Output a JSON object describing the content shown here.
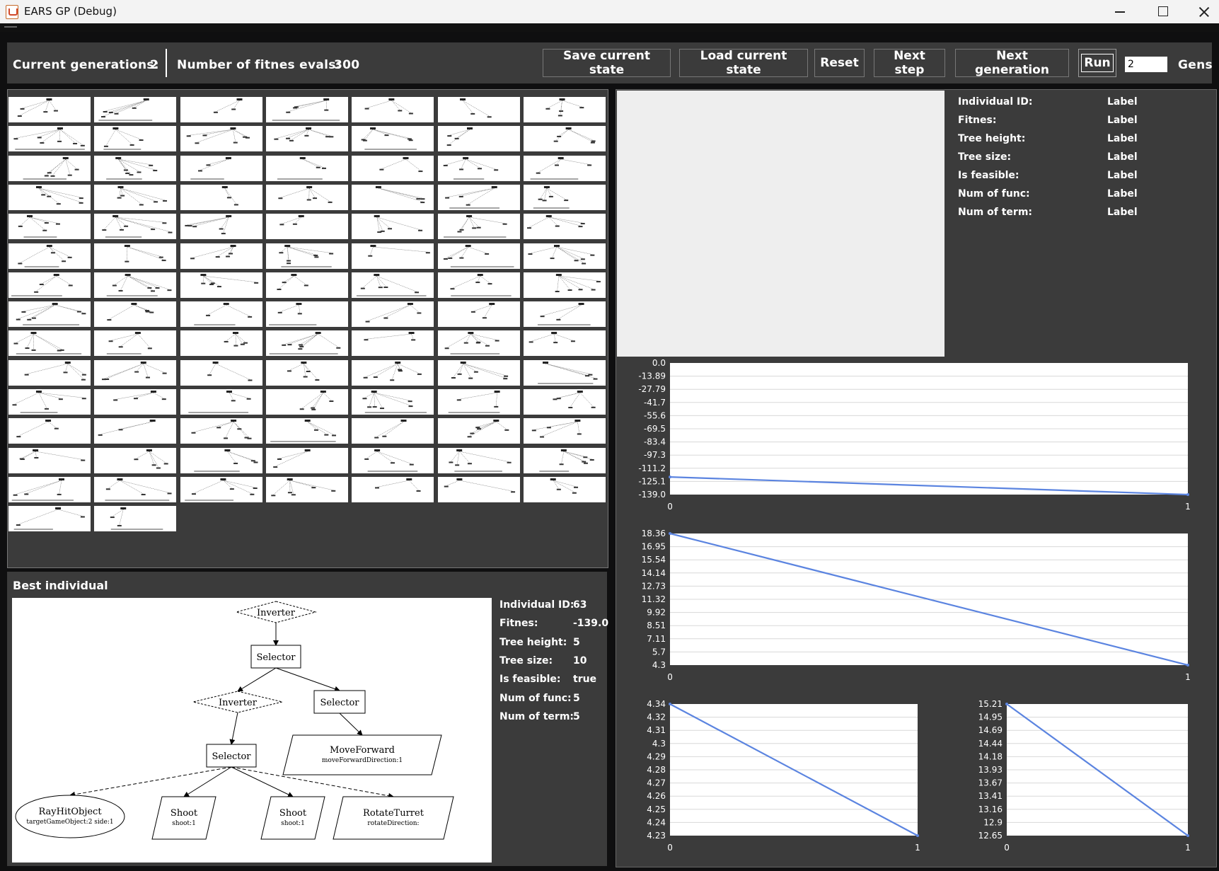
{
  "window": {
    "title": "EARS GP (Debug)"
  },
  "toolbar": {
    "generations_label": "Current generations:",
    "generations_value": "2",
    "evals_label": "Number of fitnes evals:",
    "evals_value": "300",
    "save_label": "Save current state",
    "load_label": "Load current state",
    "reset_label": "Reset",
    "next_step_label": "Next step",
    "next_generation_label": "Next generation",
    "run_label": "Run",
    "gens_value": "2",
    "gens_label": "Gens"
  },
  "population": {
    "count": 100
  },
  "selected": {
    "labels": [
      "Individual ID:",
      "Fitnes:",
      "Tree height:",
      "Tree size:",
      "Is feasible:",
      "Num of func:",
      "Num of term:"
    ],
    "values": [
      "Label",
      "Label",
      "Label",
      "Label",
      "Label",
      "Label",
      "Label"
    ]
  },
  "best": {
    "title": "Best individual",
    "labels": [
      "Individual ID:",
      "Fitnes:",
      "Tree height:",
      "Tree size:",
      "Is feasible:",
      "Num of func:",
      "Num of term:"
    ],
    "values": [
      "63",
      "-139.0",
      "5",
      "10",
      "true",
      "5",
      "5"
    ],
    "tree": {
      "nodes": [
        {
          "id": "n1",
          "label": "Inverter",
          "sub": "",
          "shape": "diamond"
        },
        {
          "id": "n2",
          "label": "Selector",
          "sub": "",
          "shape": "box"
        },
        {
          "id": "n3",
          "label": "Inverter",
          "sub": "",
          "shape": "diamond"
        },
        {
          "id": "n4",
          "label": "Selector",
          "sub": "",
          "shape": "box"
        },
        {
          "id": "n5",
          "label": "MoveForward",
          "sub": "moveForwardDirection:1",
          "shape": "parallelogram"
        },
        {
          "id": "n6",
          "label": "Selector",
          "sub": "",
          "shape": "box"
        },
        {
          "id": "n7",
          "label": "RayHitObject",
          "sub": "targetGameObject:2 side:1",
          "shape": "ellipse"
        },
        {
          "id": "n8",
          "label": "Shoot",
          "sub": "shoot:1",
          "shape": "parallelogram"
        },
        {
          "id": "n9",
          "label": "Shoot",
          "sub": "shoot:1",
          "shape": "parallelogram"
        },
        {
          "id": "n10",
          "label": "RotateTurret",
          "sub": "rotateDirection:",
          "shape": "parallelogram"
        }
      ],
      "edges": [
        [
          "n1",
          "n2"
        ],
        [
          "n2",
          "n3"
        ],
        [
          "n2",
          "n4"
        ],
        [
          "n4",
          "n5"
        ],
        [
          "n3",
          "n6"
        ],
        [
          "n6",
          "n7"
        ],
        [
          "n6",
          "n8"
        ],
        [
          "n6",
          "n9"
        ],
        [
          "n6",
          "n10"
        ]
      ]
    }
  },
  "colors": {
    "line": "#5b84e0",
    "panel": "#3b3b3b",
    "background": "#0f0f10"
  },
  "chart_data": [
    {
      "type": "line",
      "x": [
        0,
        1
      ],
      "series": [
        {
          "values": [
            -120.4,
            -139.0
          ]
        }
      ],
      "y_ticks": [
        "0.0",
        "-13.89",
        "-27.79",
        "-41.7",
        "-55.6",
        "-69.5",
        "-83.4",
        "-97.3",
        "-111.2",
        "-125.1",
        "-139.0"
      ],
      "x_ticks": [
        "0",
        "1"
      ],
      "ylim": [
        -139.0,
        0.0
      ],
      "grid": true
    },
    {
      "type": "line",
      "x": [
        0,
        1
      ],
      "series": [
        {
          "values": [
            18.36,
            4.3
          ]
        }
      ],
      "y_ticks": [
        "18.36",
        "16.95",
        "15.54",
        "14.14",
        "12.73",
        "11.32",
        "9.92",
        "8.51",
        "7.11",
        "5.7",
        "4.3"
      ],
      "x_ticks": [
        "0",
        "1"
      ],
      "ylim": [
        4.3,
        18.36
      ],
      "grid": true
    },
    {
      "type": "line",
      "x": [
        0,
        1
      ],
      "series": [
        {
          "values": [
            4.34,
            4.23
          ]
        }
      ],
      "y_ticks": [
        "4.34",
        "4.32",
        "4.31",
        "4.3",
        "4.29",
        "4.28",
        "4.27",
        "4.26",
        "4.25",
        "4.24",
        "4.23"
      ],
      "x_ticks": [
        "0",
        "1"
      ],
      "ylim": [
        4.23,
        4.34
      ],
      "grid": true
    },
    {
      "type": "line",
      "x": [
        0,
        1
      ],
      "series": [
        {
          "values": [
            15.21,
            12.65
          ]
        }
      ],
      "y_ticks": [
        "15.21",
        "14.95",
        "14.69",
        "14.44",
        "14.18",
        "13.93",
        "13.67",
        "13.41",
        "13.16",
        "12.9",
        "12.65"
      ],
      "x_ticks": [
        "0",
        "1"
      ],
      "ylim": [
        12.65,
        15.21
      ],
      "grid": true
    }
  ]
}
